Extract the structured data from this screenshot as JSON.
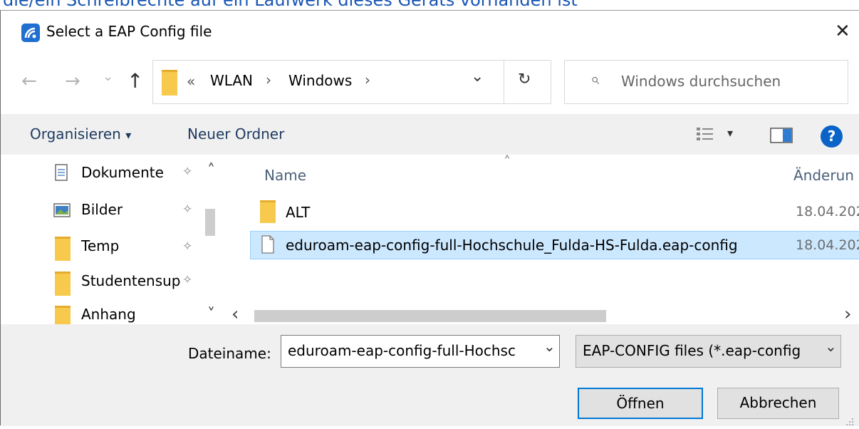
{
  "window": {
    "title": "Select a EAP Config file",
    "close_glyph": "✕",
    "top_cut_text": "die/ein Schreibrechte auf ein Laufwerk dieses Geräts vorhanden ist"
  },
  "nav": {
    "back_glyph": "←",
    "forward_glyph": "→",
    "recent_glyph": "⌄",
    "up_glyph": "↑",
    "breadcrumb_prefix": "«",
    "breadcrumb": [
      "WLAN",
      "Windows"
    ],
    "breadcrumb_sep": "›",
    "dropdown_glyph": "⌄",
    "refresh_glyph": "↻",
    "search_placeholder": "Windows durchsuchen",
    "search_icon": "⌕"
  },
  "toolbar": {
    "organize_label": "Organisieren",
    "organize_arrow": "▾",
    "new_folder_label": "Neuer Ordner",
    "view_arrow": "▾",
    "help_glyph": "?"
  },
  "sidebar": {
    "items": [
      {
        "label": "Dokumente",
        "icon": "document-icon"
      },
      {
        "label": "Bilder",
        "icon": "pictures-icon"
      },
      {
        "label": "Temp",
        "icon": "folder-icon"
      },
      {
        "label": "Studentensup",
        "icon": "folder-icon"
      },
      {
        "label": "Anhang",
        "icon": "folder-icon"
      }
    ],
    "pin_glyph": "✧",
    "scroll_up": "˄",
    "scroll_down": "˅"
  },
  "files": {
    "columns": [
      "Name",
      "Änderun"
    ],
    "sort_glyph": "˄",
    "rows": [
      {
        "name": "ALT",
        "date": "18.04.202",
        "type": "folder"
      },
      {
        "name": "eduroam-eap-config-full-Hochschule_Fulda-HS-Fulda.eap-config",
        "date": "18.04.202",
        "type": "file",
        "selected": true
      }
    ],
    "hscroll_left": "‹",
    "hscroll_right": "›"
  },
  "footer": {
    "filename_label": "Dateiname:",
    "filename_value": "eduroam-eap-config-full-Hochsc",
    "filetype_value": "EAP-CONFIG files (*.eap-config",
    "combo_arrow": "⌄",
    "open_label": "Öffnen",
    "cancel_label": "Abbrechen"
  },
  "colors": {
    "selection_bg": "#cce8ff",
    "selection_border": "#99d1ff",
    "folder": "#f7c94c",
    "accent_blue": "#0a64c8"
  }
}
